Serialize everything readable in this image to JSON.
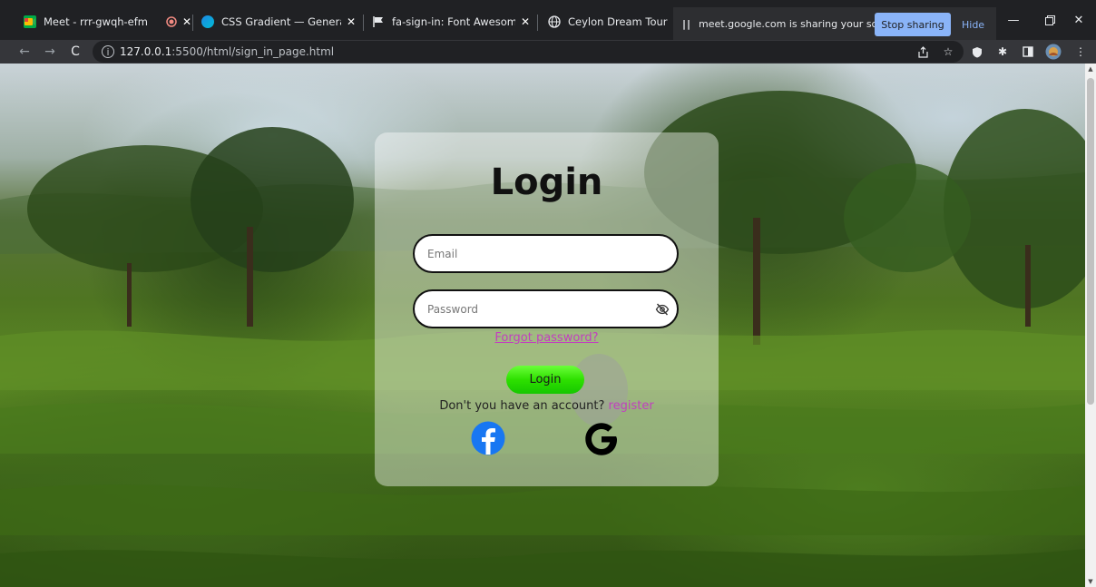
{
  "tabs": [
    {
      "label": "Meet - rrr-gwqh-efm",
      "icon": "google-meet-icon",
      "recording": true
    },
    {
      "label": "CSS Gradient — Generator, M",
      "icon": "css-gradient-icon"
    },
    {
      "label": "fa-sign-in: Font Awesome Ico",
      "icon": "font-awesome-flag-icon"
    },
    {
      "label": "Ceylon Dream Tour",
      "icon": "globe-icon"
    }
  ],
  "share_banner": {
    "message": "meet.google.com is sharing your screen.",
    "stop_label": "Stop sharing",
    "hide_label": "Hide"
  },
  "address_bar": {
    "host": "127.0.0.1",
    "path": ":5500/html/sign_in_page.html"
  },
  "login": {
    "title": "Login",
    "email_placeholder": "Email",
    "password_placeholder": "Password",
    "forgot_label": "Forgot password?",
    "button_label": "Login",
    "no_account_text": "Don't you have an account?",
    "register_label": "register"
  },
  "colors": {
    "accent_link": "#c23fbf",
    "login_button": "#2ee000",
    "facebook": "#1877f2",
    "stop_sharing": "#8ab4f8"
  }
}
